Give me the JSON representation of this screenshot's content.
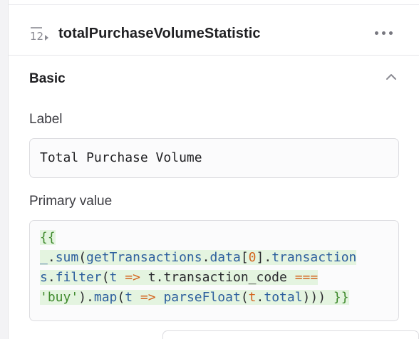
{
  "header": {
    "component_icon": "number-stat-icon",
    "component_name": "totalPurchaseVolumeStatistic",
    "more_icon": "more-horizontal-icon"
  },
  "section": {
    "title": "Basic",
    "collapse_icon": "chevron-up-icon"
  },
  "label_field": {
    "label": "Label",
    "value": "Total Purchase Volume"
  },
  "primary_value_field": {
    "label": "Primary value",
    "code_lines": [
      "{{",
      "_.sum(getTransactions.data[0].transaction",
      "s.filter(t => t.transaction_code ===",
      "'buy').map(t => parseFloat(t.total))) }}"
    ]
  },
  "colors": {
    "code_green": "#3f8a2d",
    "code_blue": "#2d5f9e",
    "code_orange": "#d4651f",
    "code_highlight": "#e4f4e0"
  }
}
